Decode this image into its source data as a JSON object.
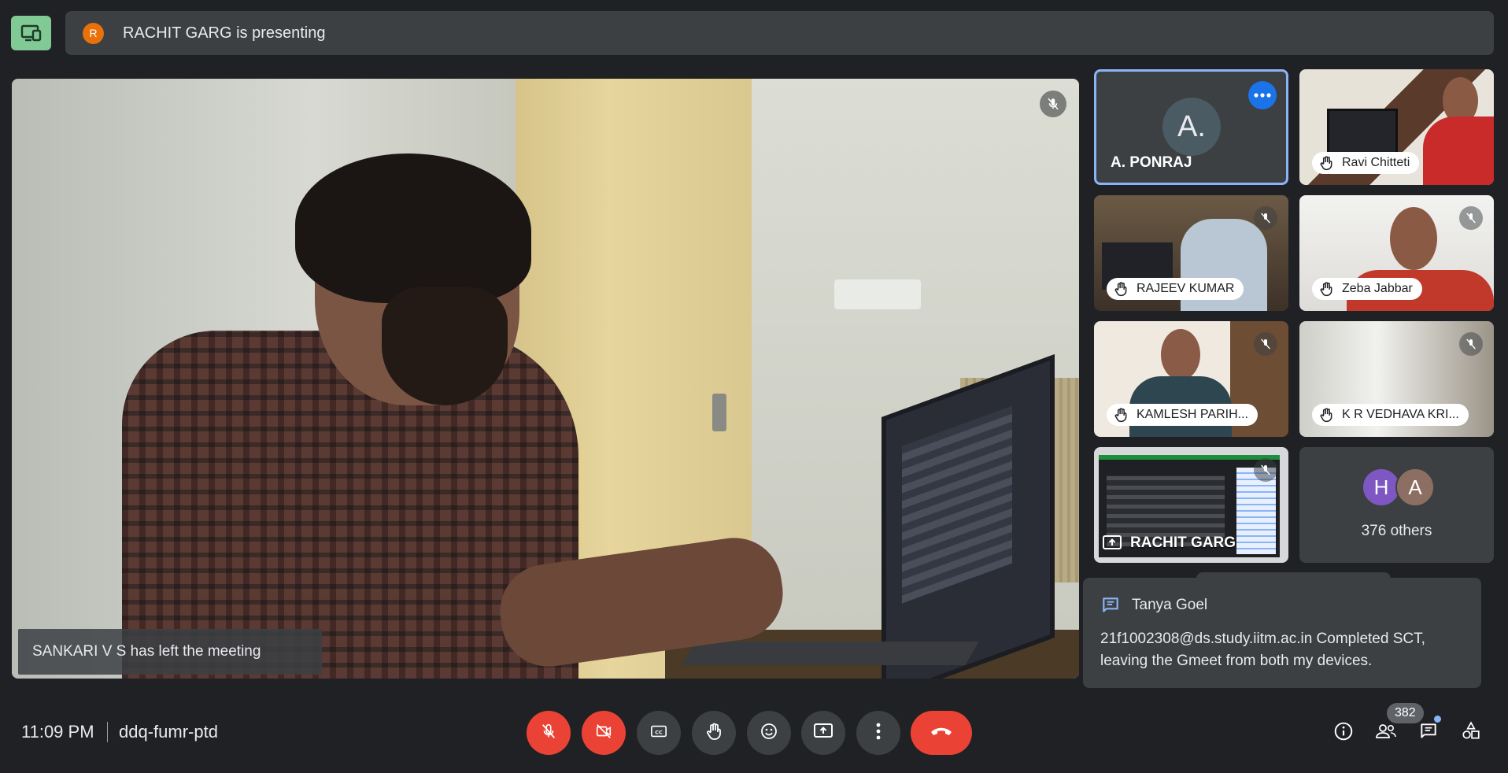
{
  "presenting": {
    "avatar_initial": "R",
    "text": "RACHIT GARG is presenting"
  },
  "main_video": {
    "notification": "SANKARI V S has left the meeting",
    "muted": true
  },
  "tiles": [
    {
      "name": "A. PONRAJ",
      "avatar": "A.",
      "selected": true
    },
    {
      "name": "Ravi Chitteti",
      "hand_raised": true
    },
    {
      "name": "RAJEEV KUMAR",
      "hand_raised": true,
      "muted": true
    },
    {
      "name": "Zeba Jabbar",
      "hand_raised": true,
      "muted": true
    },
    {
      "name": "KAMLESH PARIH...",
      "hand_raised": true,
      "muted": true
    },
    {
      "name": "K R VEDHAVA KRI...",
      "hand_raised": true,
      "muted": true
    },
    {
      "name": "RACHIT GARG",
      "presenting": true,
      "muted": true
    },
    {
      "others_label": "376 others",
      "avatars": [
        "H",
        "A"
      ]
    }
  ],
  "chat_toast": {
    "sender": "Tanya Goel",
    "message": "21f1002308@ds.study.iitm.ac.in Completed SCT, leaving the Gmeet from both my devices."
  },
  "bottom_bar": {
    "time": "11:09 PM",
    "meeting_code": "ddq-fumr-ptd",
    "participants_count": "382"
  },
  "colors": {
    "background": "#202124",
    "surface": "#3c4043",
    "danger": "#ea4335",
    "accent": "#8ab4f8",
    "present_green": "#81c995"
  },
  "icons": [
    "present-screen-icon",
    "mic-off-icon",
    "camera-off-icon",
    "captions-icon",
    "raise-hand-icon",
    "emoji-icon",
    "present-now-icon",
    "more-options-icon",
    "end-call-icon",
    "info-icon",
    "people-icon",
    "chat-icon",
    "activities-icon"
  ]
}
